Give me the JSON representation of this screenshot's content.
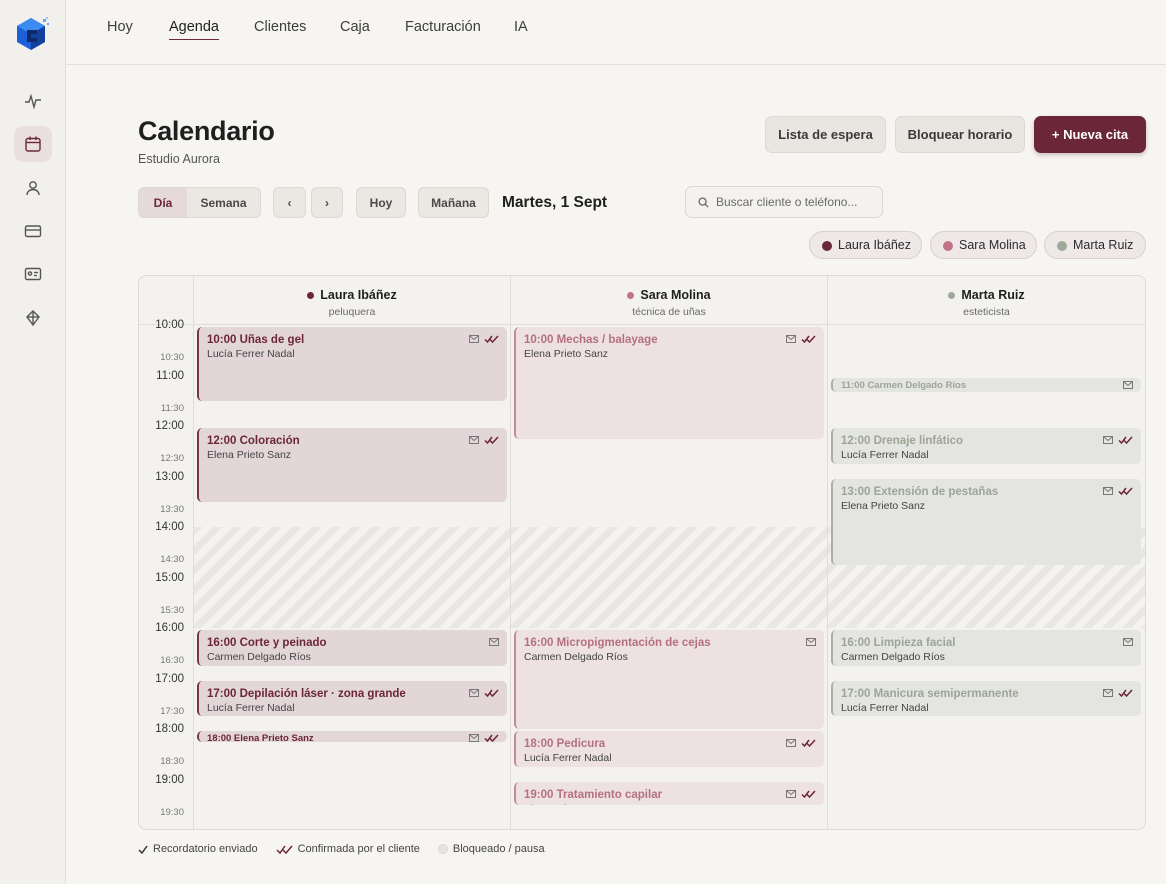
{
  "nav": {
    "tabs": [
      "Hoy",
      "Agenda",
      "Clientes",
      "Caja",
      "Facturación",
      "IA"
    ],
    "active_tab": "Agenda"
  },
  "rail": {
    "items": [
      "activity-icon",
      "calendar-icon",
      "user-icon",
      "credit-card-icon",
      "id-card-icon",
      "ai-brain-icon"
    ]
  },
  "header": {
    "title": "Calendario",
    "subtitle": "Estudio Aurora",
    "waitlist_label": "Lista de espera",
    "block_label": "Bloquear horario",
    "new_label": "+ Nueva cita"
  },
  "toolbar": {
    "view_day": "Día",
    "view_week": "Semana",
    "prev": "‹",
    "next": "›",
    "today": "Hoy",
    "tomorrow": "Mañana",
    "date": "Martes, 1 Sept",
    "search_placeholder": "Buscar cliente o teléfono..."
  },
  "filters": [
    "Laura Ibáñez",
    "Sara Molina",
    "Marta Ruiz"
  ],
  "colors": {
    "laura": "#6b2637",
    "sara": "#c27386",
    "marta": "#9fa99a",
    "primary": "#6b2637"
  },
  "staff": [
    {
      "name": "Laura Ibáñez",
      "role": "peluquera"
    },
    {
      "name": "Sara Molina",
      "role": "técnica de uñas"
    },
    {
      "name": "Marta Ruiz",
      "role": "esteticista"
    }
  ],
  "times": [
    "10:00",
    "10:30",
    "11:00",
    "11:30",
    "12:00",
    "12:30",
    "13:00",
    "13:30",
    "14:00",
    "14:30",
    "15:00",
    "15:30",
    "16:00",
    "16:30",
    "17:00",
    "17:30",
    "18:00",
    "18:30",
    "19:00",
    "19:30"
  ],
  "appointments": [
    {
      "col": 0,
      "title": "10:00 Uñas de gel",
      "client": "Lucía Ferrer Nadal",
      "start": "10:00",
      "end": "11:30",
      "reminder": true,
      "confirmed": true
    },
    {
      "col": 0,
      "title": "12:00 Coloración",
      "client": "Elena Prieto Sanz",
      "start": "12:00",
      "end": "13:30",
      "reminder": true,
      "confirmed": true
    },
    {
      "col": 0,
      "title": "16:00 Corte y peinado",
      "client": "Carmen Delgado Ríos",
      "start": "16:00",
      "end": "16:45",
      "reminder": true,
      "confirmed": false
    },
    {
      "col": 0,
      "title": "17:00 Depilación láser · zona grande",
      "client": "Lucía Ferrer Nadal",
      "start": "17:00",
      "end": "17:45",
      "reminder": true,
      "confirmed": true
    },
    {
      "col": 0,
      "title": "18:00 Elena Prieto Sanz",
      "client": "",
      "start": "18:00",
      "end": "18:15",
      "reminder": true,
      "confirmed": true
    },
    {
      "col": 1,
      "title": "10:00 Mechas / balayage",
      "client": "Elena Prieto Sanz",
      "start": "10:00",
      "end": "12:15",
      "reminder": true,
      "confirmed": true
    },
    {
      "col": 1,
      "title": "16:00 Micropigmentación de cejas",
      "client": "Carmen Delgado Ríos",
      "start": "16:00",
      "end": "18:00",
      "reminder": true,
      "confirmed": false
    },
    {
      "col": 1,
      "title": "18:00 Pedicura",
      "client": "Lucía Ferrer Nadal",
      "start": "18:00",
      "end": "18:45",
      "reminder": true,
      "confirmed": true
    },
    {
      "col": 1,
      "title": "19:00 Tratamiento capilar",
      "client": "Elena Prieto Sanz",
      "start": "19:00",
      "end": "19:30",
      "reminder": true,
      "confirmed": true
    },
    {
      "col": 2,
      "title": "11:00 Carmen Delgado Ríos",
      "client": "",
      "start": "11:00",
      "end": "11:20",
      "reminder": true,
      "confirmed": false
    },
    {
      "col": 2,
      "title": "12:00 Drenaje linfático",
      "client": "Lucía Ferrer Nadal",
      "start": "12:00",
      "end": "12:45",
      "reminder": true,
      "confirmed": true
    },
    {
      "col": 2,
      "title": "13:00 Extensión de pestañas",
      "client": "Elena Prieto Sanz",
      "start": "13:00",
      "end": "14:45",
      "reminder": true,
      "confirmed": true
    },
    {
      "col": 2,
      "title": "16:00 Limpieza facial",
      "client": "Carmen Delgado Ríos",
      "start": "16:00",
      "end": "16:45",
      "reminder": true,
      "confirmed": false
    },
    {
      "col": 2,
      "title": "17:00 Manicura semipermanente",
      "client": "Lucía Ferrer Nadal",
      "start": "17:00",
      "end": "17:45",
      "reminder": true,
      "confirmed": true
    }
  ],
  "blocked": {
    "start": "14:00",
    "end": "16:00"
  },
  "legend": {
    "reminder": "Recordatorio enviado",
    "confirmed": "Confirmada por el cliente",
    "blocked": "Bloqueado / pausa"
  }
}
